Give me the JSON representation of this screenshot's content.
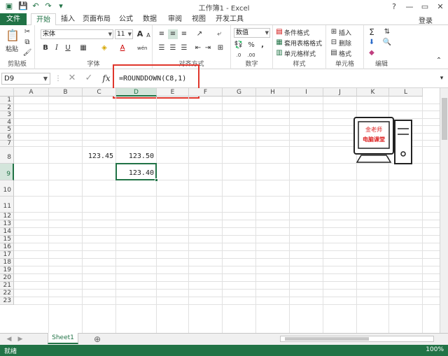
{
  "window": {
    "title": "工作簿1 - Excel",
    "minimize": "—",
    "restore": "▭",
    "close": "✕",
    "help": "?"
  },
  "tabs": {
    "file": "文件",
    "items": [
      "开始",
      "插入",
      "页面布局",
      "公式",
      "数据",
      "审阅",
      "视图",
      "开发工具"
    ],
    "active": "开始",
    "login": "登录"
  },
  "ribbon": {
    "clipboard": {
      "paste": "粘贴",
      "label": "剪贴板"
    },
    "font": {
      "name": "宋体",
      "size": "11",
      "label": "字体",
      "bold": "B",
      "italic": "I",
      "underline": "U",
      "grow": "A",
      "shrink": "A",
      "fontcolor": "A",
      "phonetic": "wén"
    },
    "alignment": {
      "label": "对齐方式"
    },
    "number": {
      "format": "数值",
      "label": "数字",
      "percent": "%",
      "comma": ","
    },
    "styles": {
      "conditional": "条件格式",
      "table": "套用表格格式",
      "cell": "单元格样式",
      "label": "样式"
    },
    "cells": {
      "insert": "插入",
      "delete": "删除",
      "format": "格式",
      "label": "单元格"
    },
    "editing": {
      "sum": "Σ",
      "label": "编辑"
    }
  },
  "formula_bar": {
    "name_box": "D9",
    "cancel": "✕",
    "enter": "✓",
    "fx": "fx",
    "formula": "=ROUNDDOWN(C8,1)"
  },
  "grid": {
    "columns": [
      "A",
      "B",
      "C",
      "D",
      "E",
      "F",
      "G",
      "H",
      "I",
      "J",
      "K",
      "L"
    ],
    "rows": [
      "1",
      "2",
      "3",
      "4",
      "5",
      "6",
      "7",
      "8",
      "9",
      "10",
      "11",
      "12",
      "13",
      "14",
      "15",
      "16",
      "17",
      "18",
      "19",
      "20",
      "21",
      "22",
      "23"
    ],
    "cells": {
      "C8": "123.45",
      "D8": "123.50",
      "D9": "123.40"
    },
    "active_cell": "D9"
  },
  "logo": {
    "line1": "金老师",
    "line2": "电脑课堂"
  },
  "sheets": {
    "tabs": [
      "Sheet1"
    ],
    "add": "⊕"
  },
  "status": {
    "ready": "就绪",
    "zoom": "100%"
  }
}
